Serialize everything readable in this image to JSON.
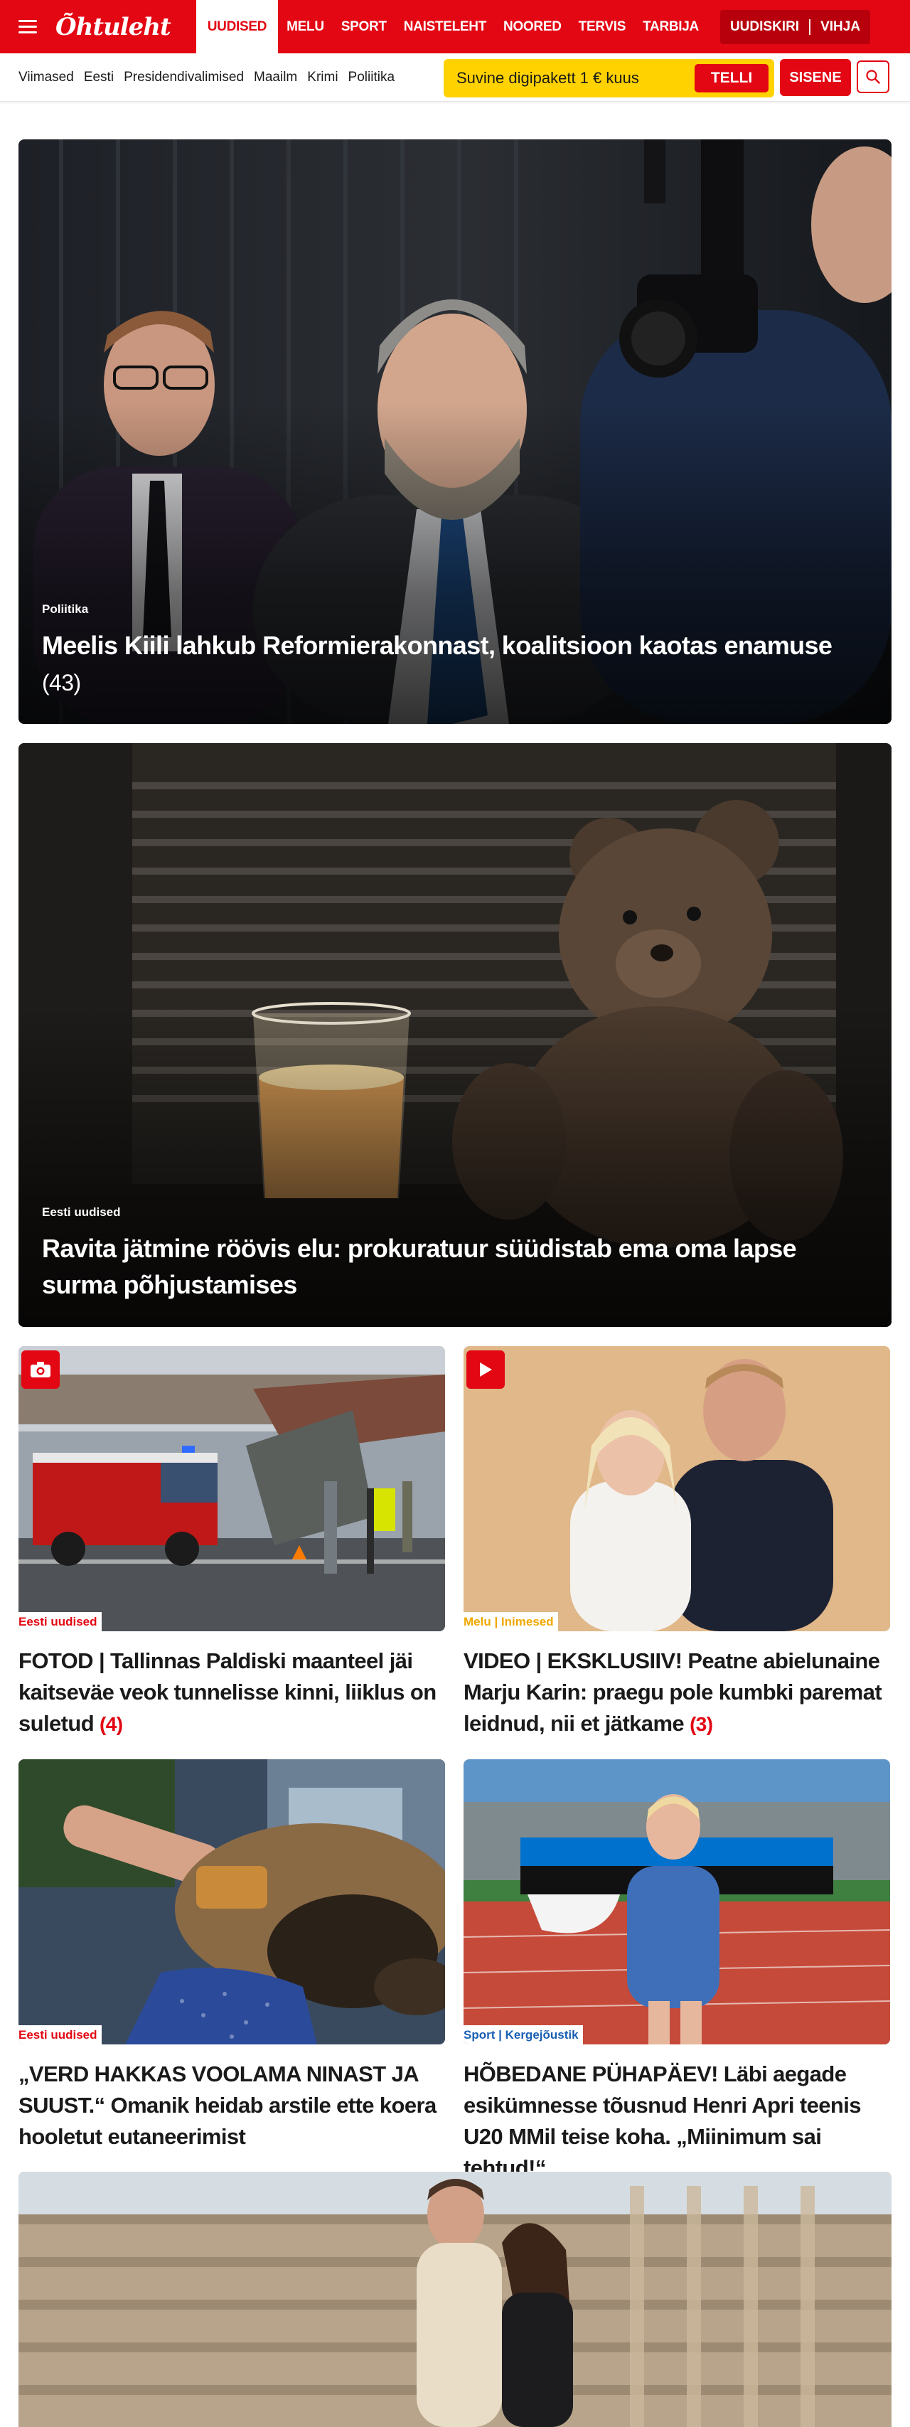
{
  "header": {
    "logo_text": "Õhtuleht",
    "nav": [
      "UUDISED",
      "MELU",
      "SPORT",
      "NAISTELEHT",
      "NOORED",
      "TERVIS",
      "TARBIJA"
    ],
    "active_nav": "UUDISED",
    "right_links": [
      "UUDISKIRI",
      "VIHJA"
    ]
  },
  "subnav": {
    "links": [
      "Viimased",
      "Eesti",
      "Presidendivalimised",
      "Maailm",
      "Krimi",
      "Poliitika"
    ],
    "promo_text": "Suvine digipakett 1 € kuus",
    "promo_button": "TELLI",
    "login_button": "SISENE"
  },
  "articles": {
    "a1": {
      "kicker": "Poliitika",
      "title": "Meelis Kiili lahkub Reformierakonnast, koalitsioon kaotas enamuse",
      "comments": "(43)"
    },
    "a2": {
      "kicker": "Eesti uudised",
      "title": "Ravita jätmine röövis elu: prokuratuur süüdistab ema oma lapse surma põhjustamises"
    },
    "a3": {
      "tag": "Eesti uudised",
      "title": "FOTOD | Tallinnas Paldiski maanteel jäi kaitseväe veok tunnelisse kinni, liiklus on suletud",
      "comments": "(4)",
      "badge": "camera-icon"
    },
    "a4": {
      "tag": "Melu | Inimesed",
      "title": "VIDEO | EKSKLUSIIV! Peatne abielunaine Marju Karin: praegu pole kumbki paremat leidnud, nii et jätkame",
      "comments": "(3)",
      "badge": "play-icon"
    },
    "a5": {
      "tag": "Eesti uudised",
      "title": "„VERD HAKKAS VOOLAMA NINAST JA SUUST.“ Omanik heidab arstile ette koera hooletut eutaneerimist"
    },
    "a6": {
      "tag": "Sport | Kergejõustik",
      "title": "HÕBEDANE PÜHAPÄEV! Läbi aegade esikümnesse tõusnud Henri Apri teenis U20 MMil teise koha. „Miinimum sai tehtud!“"
    }
  },
  "colors": {
    "brand_red": "#e30613",
    "promo_yellow": "#ffd200",
    "tag_red": "#e30613",
    "tag_yellow": "#f0a800",
    "tag_blue": "#1a5fb4"
  }
}
